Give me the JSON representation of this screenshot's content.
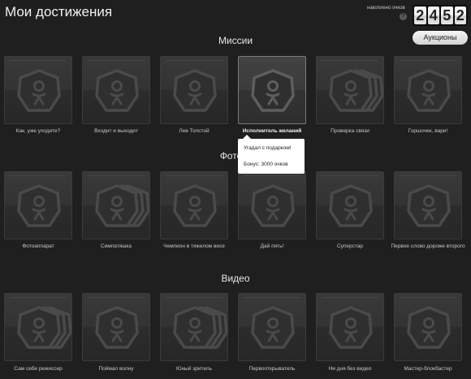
{
  "page": {
    "title": "Мои достижения",
    "score_label": "накоплено очков",
    "score_digits": [
      "2",
      "4",
      "5",
      "2"
    ],
    "help_icon": "?",
    "auction_button": "Аукционы"
  },
  "sections": [
    {
      "title": "Миссии",
      "items": [
        {
          "label": "Как, уже уходите?",
          "badge": "single",
          "active": false
        },
        {
          "label": "Входит и выходит",
          "badge": "single",
          "active": false
        },
        {
          "label": "Лев Толстой",
          "badge": "single",
          "active": false
        },
        {
          "label": "Исполнитель желаний",
          "badge": "single",
          "active": true
        },
        {
          "label": "Проверка связи",
          "badge": "stack",
          "active": false
        },
        {
          "label": "Горшочек, вари!",
          "badge": "single",
          "active": false
        }
      ]
    },
    {
      "title": "Фотогр",
      "items": [
        {
          "label": "Фотоаппарат",
          "badge": "single",
          "active": false
        },
        {
          "label": "Симпатяшка",
          "badge": "stack",
          "active": false
        },
        {
          "label": "Чемпион в тяжелом весе",
          "badge": "single",
          "active": false
        },
        {
          "label": "Дай пять!",
          "badge": "single",
          "active": false
        },
        {
          "label": "Суперстар",
          "badge": "single",
          "active": false
        },
        {
          "label": "Первое слово дороже второго",
          "badge": "single",
          "active": false
        }
      ]
    },
    {
      "title": "Видео",
      "items": [
        {
          "label": "Сам себе режиссер",
          "badge": "stack",
          "active": false
        },
        {
          "label": "Поймал волну",
          "badge": "single",
          "active": false
        },
        {
          "label": "Юный зритель",
          "badge": "stack",
          "active": false
        },
        {
          "label": "Первооткрыватель",
          "badge": "single",
          "active": false
        },
        {
          "label": "Ни дня без видео",
          "badge": "single",
          "active": false
        },
        {
          "label": "Мастер-блокбастер",
          "badge": "single",
          "active": false
        }
      ]
    }
  ],
  "tooltip": {
    "title": "Угадал с подарком!",
    "bonus": "Бонус: 3000 очков"
  },
  "colors": {
    "background": "#1f1f1f",
    "badge_stroke": "#4a4a4a",
    "badge_stroke_active": "#5e5e5e"
  }
}
